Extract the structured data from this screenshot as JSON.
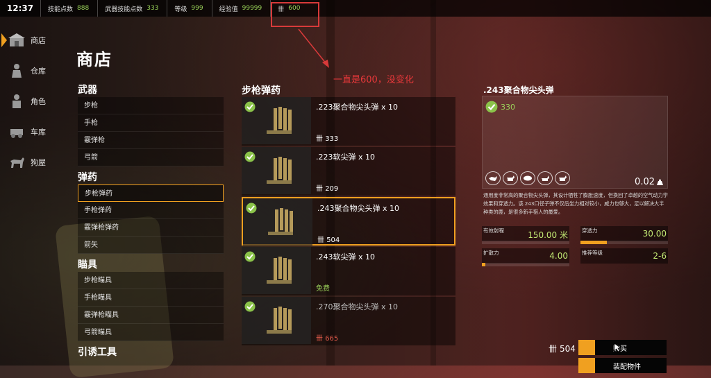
{
  "topbar": {
    "time": "12:37",
    "stats": [
      {
        "label": "技能点数",
        "value": "888"
      },
      {
        "label": "武器技能点数",
        "value": "333"
      },
      {
        "label": "等级",
        "value": "999"
      },
      {
        "label": "经验值",
        "value": "99999"
      }
    ],
    "currency_symbol": "卌",
    "currency_value": "600"
  },
  "annotation": {
    "text": "一直是600，没变化",
    "color": "#e8383a"
  },
  "sidenav": {
    "items": [
      {
        "label": "商店",
        "icon": "store-icon",
        "active": true
      },
      {
        "label": "仓库",
        "icon": "warehouse-icon",
        "active": false
      },
      {
        "label": "角色",
        "icon": "character-icon",
        "active": false
      },
      {
        "label": "车库",
        "icon": "garage-icon",
        "active": false
      },
      {
        "label": "狗屋",
        "icon": "dog-icon",
        "active": false
      }
    ]
  },
  "page_title": "商店",
  "categories": {
    "groups": [
      {
        "header": "武器",
        "items": [
          "步枪",
          "手枪",
          "霰弹枪",
          "弓箭"
        ]
      },
      {
        "header": "弹药",
        "items": [
          "步枪弹药",
          "手枪弹药",
          "霰弹枪弹药",
          "箭矢"
        ]
      },
      {
        "header": "瞄具",
        "items": [
          "步枪瞄具",
          "手枪瞄具",
          "霰弹枪瞄具",
          "弓箭瞄具"
        ]
      },
      {
        "header": "引诱工具",
        "items": []
      }
    ],
    "selected": "步枪弹药"
  },
  "product_list": {
    "title": "步枪弹药",
    "items": [
      {
        "name": ".223聚合物尖头弹 x 10",
        "price": "333",
        "owned": true
      },
      {
        "name": ".223软尖弹 x 10",
        "price": "209",
        "owned": true
      },
      {
        "name": ".243聚合物尖头弹 x 10",
        "price": "504",
        "owned": true,
        "selected": true
      },
      {
        "name": ".243软尖弹 x 10",
        "price": "免费",
        "owned": true
      },
      {
        "name": ".270聚合物尖头弹 x 10",
        "price": "665",
        "owned": true
      }
    ]
  },
  "detail": {
    "title": ".243聚合物尖头弹",
    "score": "330",
    "weight": "0.02",
    "description": "通用度非常高的聚合物尖头弹，其设计牺牲了膨胀速度，但换回了卓越的空气动力学效果和穿透力。该.243口径子弹不仅后坐力相对较小，威力也够大，足以解决大半种类的鹿，是很多新手猎人的最爱。",
    "stats": [
      {
        "label": "有效射程",
        "value": "150.00 米",
        "fill": 0
      },
      {
        "label": "穿透力",
        "value": "30.00",
        "fill": 0.3
      },
      {
        "label": "扩散力",
        "value": "4.00",
        "fill": 0.04
      },
      {
        "label": "推荐等级",
        "value": "2-6",
        "fill": 0
      }
    ]
  },
  "footer": {
    "price": "504",
    "buy_label": "购买",
    "equip_label": "装配物件"
  },
  "colors": {
    "accent": "#f0a020",
    "green": "#9bd35a",
    "red": "#e15a4a"
  }
}
